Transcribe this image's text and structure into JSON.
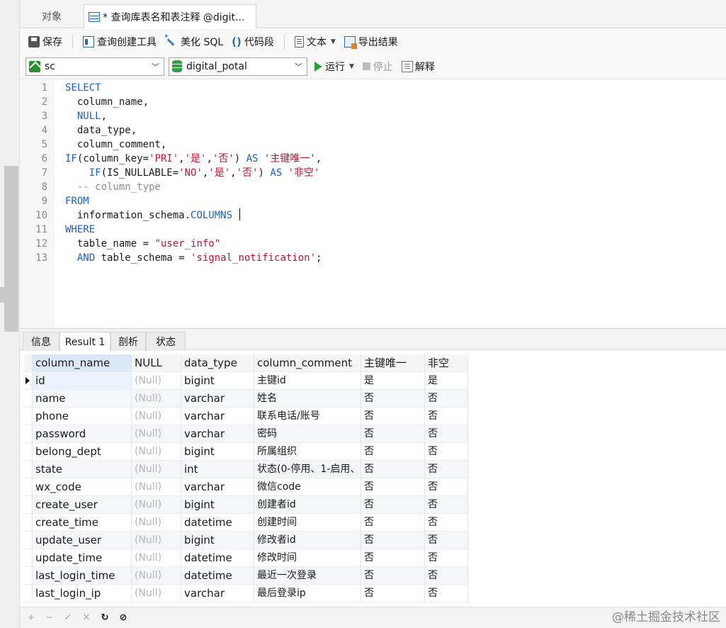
{
  "tabs": {
    "objects": "对象",
    "query": "* 查询库表名和表注释 @digit..."
  },
  "toolbar": {
    "save": "保存",
    "query_builder": "查询创建工具",
    "beautify": "美化 SQL",
    "snippet": "代码段",
    "text": "文本",
    "export": "导出结果"
  },
  "toolbar2": {
    "connection": "sc",
    "database": "digital_potal",
    "run": "运行",
    "stop": "停止",
    "explain": "解释"
  },
  "editor": {
    "line_numbers": [
      "1",
      "2",
      "3",
      "4",
      "5",
      "6",
      "7",
      "8",
      "9",
      "10",
      "11",
      "12",
      "13"
    ]
  },
  "result_tabs": [
    "信息",
    "Result 1",
    "剖析",
    "状态"
  ],
  "grid": {
    "columns": [
      "column_name",
      "NULL",
      "data_type",
      "column_comment",
      "主键唯一",
      "非空"
    ],
    "rows": [
      [
        "id",
        "(Null)",
        "bigint",
        "主键id",
        "是",
        "是"
      ],
      [
        "name",
        "(Null)",
        "varchar",
        "姓名",
        "否",
        "否"
      ],
      [
        "phone",
        "(Null)",
        "varchar",
        "联系电话/账号",
        "否",
        "否"
      ],
      [
        "password",
        "(Null)",
        "varchar",
        "密码",
        "否",
        "否"
      ],
      [
        "belong_dept",
        "(Null)",
        "bigint",
        "所属组织",
        "否",
        "否"
      ],
      [
        "state",
        "(Null)",
        "int",
        "状态(0-停用、1-启用、",
        "否",
        "否"
      ],
      [
        "wx_code",
        "(Null)",
        "varchar",
        "微信code",
        "否",
        "否"
      ],
      [
        "create_user",
        "(Null)",
        "bigint",
        "创建者id",
        "否",
        "否"
      ],
      [
        "create_time",
        "(Null)",
        "datetime",
        "创建时间",
        "否",
        "否"
      ],
      [
        "update_user",
        "(Null)",
        "bigint",
        "修改者id",
        "否",
        "否"
      ],
      [
        "update_time",
        "(Null)",
        "datetime",
        "修改时间",
        "否",
        "否"
      ],
      [
        "last_login_time",
        "(Null)",
        "datetime",
        "最近一次登录",
        "否",
        "否"
      ],
      [
        "last_login_ip",
        "(Null)",
        "varchar",
        "最后登录ip",
        "否",
        "否"
      ]
    ]
  },
  "bottombar": {
    "add": "+",
    "remove": "−",
    "apply": "✓",
    "discard": "✕",
    "refresh": "↻",
    "stop": "⊘"
  },
  "watermark": "@稀土掘金技术社区"
}
